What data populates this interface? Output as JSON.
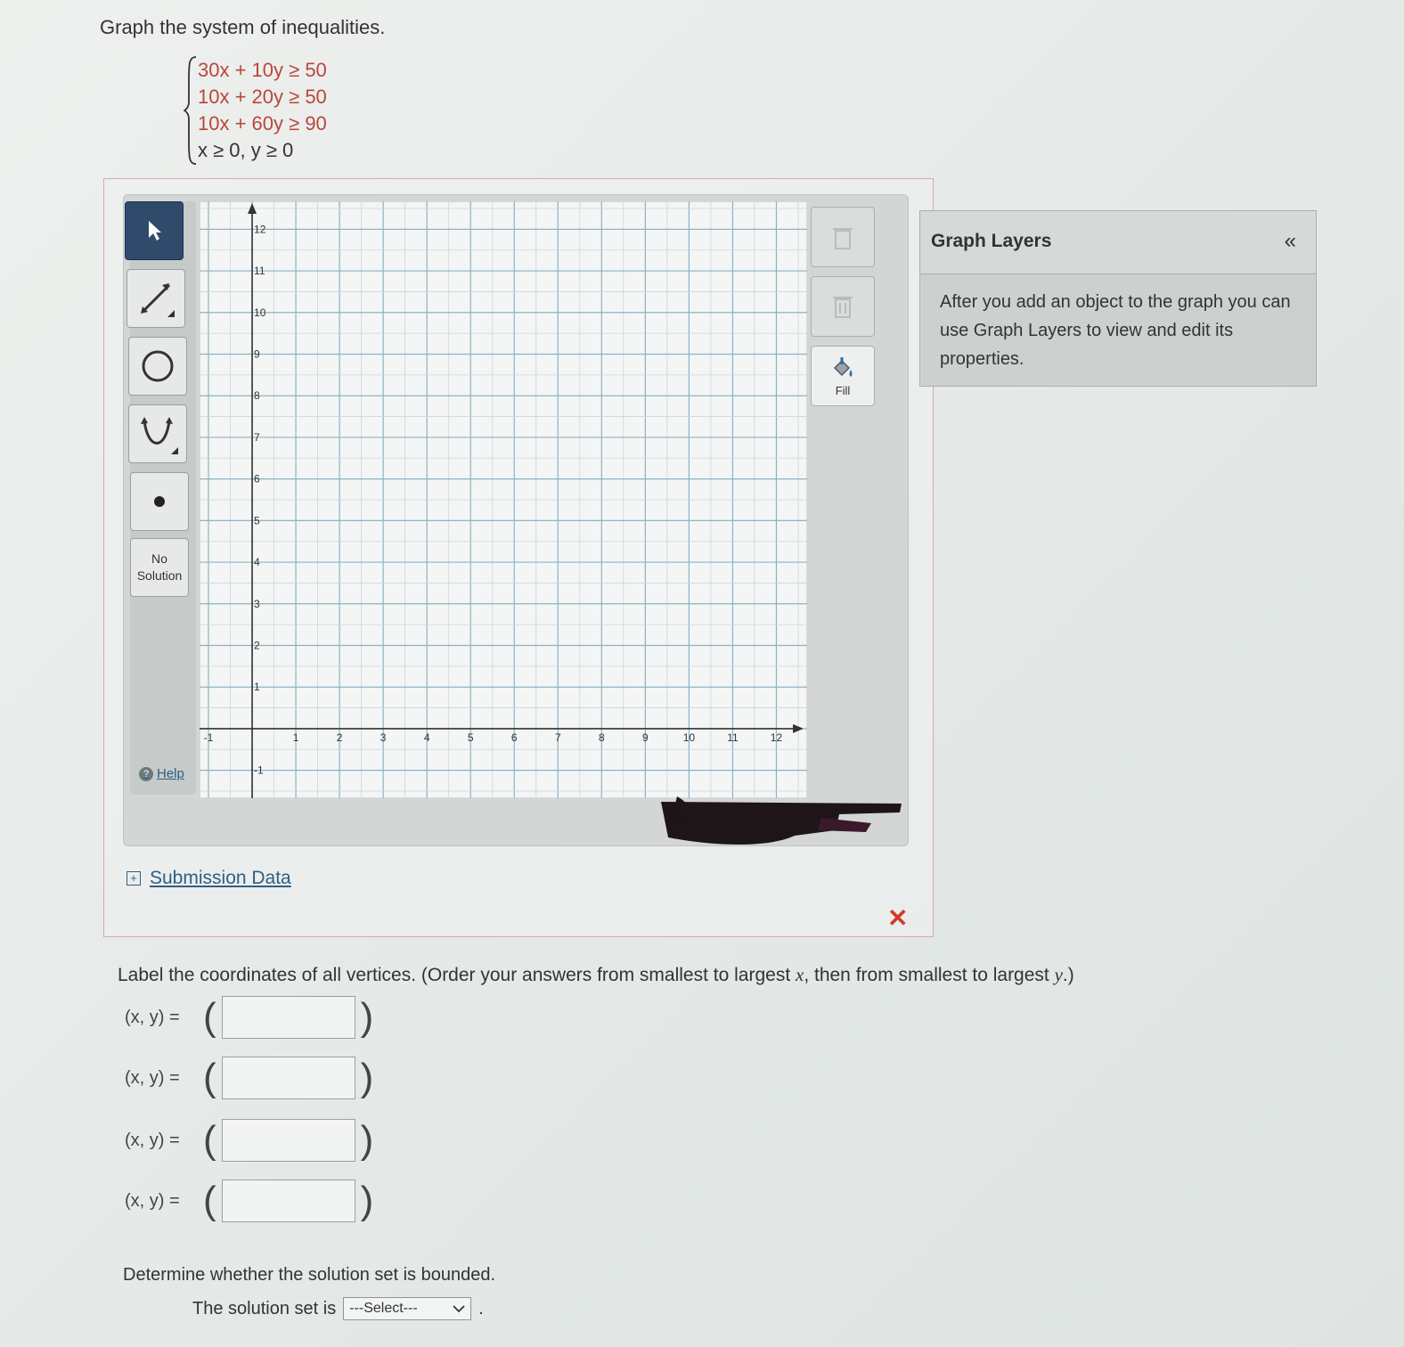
{
  "question": {
    "prompt": "Graph the system of inequalities.",
    "inequalities": [
      {
        "lhs": "30x + 10y ≥ ",
        "rhs": "50"
      },
      {
        "lhs": "10x + 20y ≥ ",
        "rhs": "50"
      },
      {
        "lhs": "10x + 60y ≥ ",
        "rhs": "90"
      },
      {
        "lhs": "x ≥ 0,    y ≥ 0",
        "rhs": ""
      }
    ]
  },
  "toolbar": {
    "no_solution_line1": "No",
    "no_solution_line2": "Solution",
    "help_label": "Help"
  },
  "graph": {
    "x_min": -1,
    "x_max": 12.5,
    "y_min": -1.5,
    "y_max": 12.5,
    "x_ticks": [
      "-1",
      "1",
      "2",
      "3",
      "4",
      "5",
      "6",
      "7",
      "8",
      "9",
      "10",
      "11",
      "12"
    ],
    "y_ticks": [
      "12",
      "11",
      "10",
      "9",
      "8",
      "7",
      "6",
      "5",
      "4",
      "3",
      "2",
      "1",
      "-1"
    ]
  },
  "side_tools": {
    "fill_label": "Fill"
  },
  "graph_layers": {
    "title": "Graph Layers",
    "collapse": "«",
    "body": "After you add an object to the graph you can use Graph Layers to view and edit its properties."
  },
  "submission": {
    "label": "Submission Data"
  },
  "vertices": {
    "instruction_a": "Label the coordinates of all vertices. (Order your answers from smallest to largest ",
    "instruction_x": "x",
    "instruction_b": ", then from smallest to largest ",
    "instruction_y": "y",
    "instruction_c": ".)",
    "rows": [
      {
        "label": "(x, y) =",
        "value": ""
      },
      {
        "label": "(x, y) =",
        "value": ""
      },
      {
        "label": "(x, y) =",
        "value": ""
      },
      {
        "label": "(x, y) =",
        "value": ""
      }
    ]
  },
  "bounded": {
    "question": "Determine whether the solution set is bounded.",
    "prefix": "The solution set is",
    "select_value": "---Select---",
    "suffix": "."
  }
}
